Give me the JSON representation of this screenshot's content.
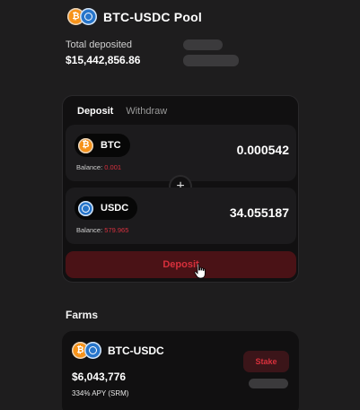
{
  "pool": {
    "title": "BTC-USDC Pool",
    "total_deposited_label": "Total deposited",
    "total_deposited_value": "$15,442,856.86"
  },
  "tabs": [
    {
      "label": "Deposit",
      "active": true
    },
    {
      "label": "Withdraw",
      "active": false
    }
  ],
  "tokens": [
    {
      "symbol": "BTC",
      "balance_label": "Balance:",
      "balance_value": "0.001",
      "amount": "0.000542"
    },
    {
      "symbol": "USDC",
      "balance_label": "Balance:",
      "balance_value": "579.965",
      "amount": "34.055187"
    }
  ],
  "plus_symbol": "+",
  "deposit_button_label": "Deposit",
  "farms": {
    "heading": "Farms",
    "items": [
      {
        "name": "BTC-USDC",
        "value": "$6,043,776",
        "apy": "334% APY (SRM)",
        "stake_label": "Stake"
      }
    ]
  },
  "colors": {
    "background": "#1e1d1e",
    "card": "#111011",
    "accent_red": "#d8303c",
    "btc": "#f7931a",
    "usdc": "#2775ca"
  },
  "icons": [
    "btc-icon",
    "usdc-icon",
    "plus-icon",
    "pointer-cursor-icon"
  ]
}
